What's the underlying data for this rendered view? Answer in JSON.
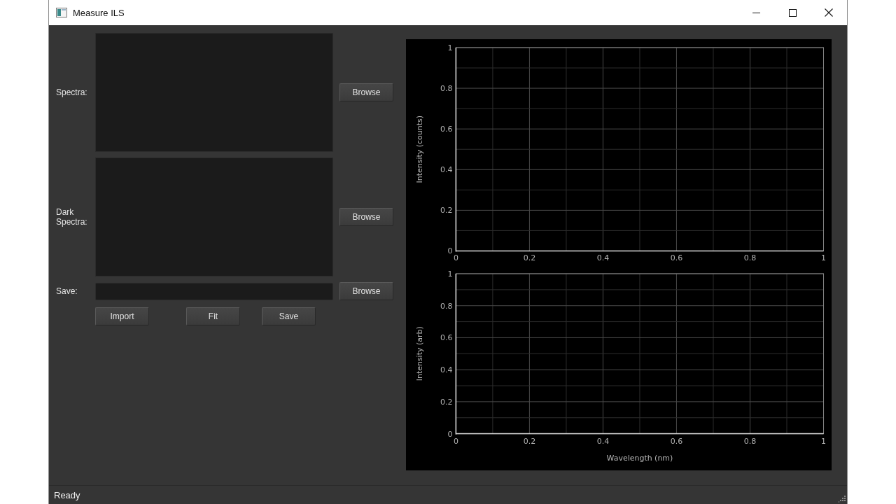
{
  "window": {
    "title": "Measure ILS"
  },
  "form": {
    "rows": [
      {
        "kind": "list",
        "label": "Spectra:",
        "button": "Browse"
      },
      {
        "kind": "list",
        "label": "Dark Spectra:",
        "button": "Browse"
      },
      {
        "kind": "field",
        "label": "Save:",
        "button": "Browse"
      }
    ],
    "actions": [
      "Import",
      "Fit",
      "Save"
    ]
  },
  "plots": [
    {
      "chart_data": {
        "type": "line",
        "ylabel": "Intensity (counts)",
        "xlim": [
          0,
          1
        ],
        "ylim": [
          0,
          1
        ],
        "xticks": [
          0,
          0.2,
          0.4,
          0.6,
          0.8,
          1
        ],
        "yticks": [
          0,
          0.2,
          0.4,
          0.6,
          0.8,
          1
        ],
        "grid": true
      }
    },
    {
      "chart_data": {
        "type": "line",
        "xlabel": "Wavelength (nm)",
        "ylabel": "Intensity (arb)",
        "xlim": [
          0,
          1
        ],
        "ylim": [
          0,
          1
        ],
        "xticks": [
          0,
          0.2,
          0.4,
          0.6,
          0.8,
          1
        ],
        "yticks": [
          0,
          0.2,
          0.4,
          0.6,
          0.8,
          1
        ],
        "grid": true
      }
    }
  ],
  "status_bar": {
    "text": "Ready"
  }
}
